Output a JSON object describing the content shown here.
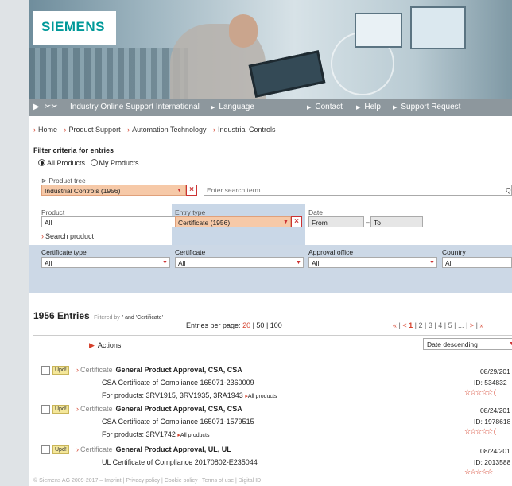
{
  "brand": {
    "logo": "SIEMENS"
  },
  "nav": {
    "portal": "Industry Online Support International",
    "language": "Language",
    "contact": "Contact",
    "help": "Help",
    "support_request": "Support Request"
  },
  "breadcrumb": [
    "Home",
    "Product Support",
    "Automation Technology",
    "Industrial Controls"
  ],
  "filter": {
    "title": "Filter criteria for entries",
    "all_products": "All Products",
    "my_products": "My Products",
    "product_tree_label": "Product tree",
    "product_tree_value": "Industrial Controls (1956)",
    "search_placeholder": "Enter search term...",
    "product_label": "Product",
    "product_value": "All",
    "search_product": "Search product",
    "entry_type_label": "Entry type",
    "entry_type_value": "Certificate (1956)",
    "date_label": "Date",
    "date_from": "From",
    "date_to": "To",
    "certificate_type_label": "Certificate type",
    "certificate_type_value": "All",
    "certificate_label": "Certificate",
    "certificate_value": "All",
    "approval_office_label": "Approval office",
    "approval_office_value": "All",
    "country_label": "Country",
    "country_value": "All"
  },
  "results": {
    "count": "1956",
    "entries_label": "Entries",
    "filtered_by": "Filtered by",
    "filter_values": "\" and 'Certificate'",
    "per_page_label": "Entries per page:",
    "per_page_options": [
      "20",
      "50",
      "100"
    ],
    "pager": {
      "first": "«",
      "prev": "<",
      "pages": [
        "1",
        "2",
        "3",
        "4",
        "5",
        "..."
      ],
      "next": ">",
      "last": "»"
    },
    "actions_label": "Actions",
    "sort_value": "Date descending"
  },
  "entries": [
    {
      "badge": "Upd!",
      "kind": "Certificate",
      "title": "General Product Approval, CSA, CSA",
      "desc": "CSA Certificate of Compliance 165071-2360009",
      "products": "For products: 3RV1915, 3RV1935, 3RA1943",
      "all_products": "All products",
      "date": "08/29/201",
      "id": "ID: 534832",
      "stars": "☆☆☆☆☆ ("
    },
    {
      "badge": "Upd!",
      "kind": "Certificate",
      "title": "General Product Approval, CSA, CSA",
      "desc": "CSA Certificate of Compliance 165071-1579515",
      "products": "For products: 3RV1742",
      "all_products": "All products",
      "date": "08/24/201",
      "id": "ID: 1978618",
      "stars": "☆☆☆☆☆ ("
    },
    {
      "badge": "Upd!",
      "kind": "Certificate",
      "title": "General Product Approval, UL, UL",
      "desc": "UL Certificate of Compliance 20170802-E235044",
      "date": "08/24/201",
      "id": "ID: 2013588",
      "stars": "☆☆☆☆☆"
    }
  ],
  "footer": "© Siemens AG 2009-2017 – Imprint | Privacy policy | Cookie policy | Terms of use | Digital ID",
  "colors": {
    "accent": "#d5402b",
    "brand": "#009999",
    "nav": "#8d979d",
    "highlight": "#f6c9a8"
  }
}
